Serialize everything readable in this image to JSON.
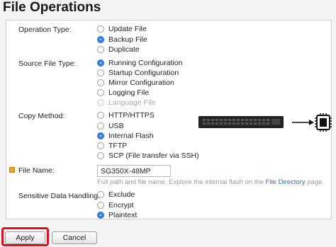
{
  "page": {
    "title": "File Operations"
  },
  "form": {
    "operation_type": {
      "label": "Operation Type:",
      "options": [
        {
          "label": "Update File",
          "checked": false,
          "disabled": false
        },
        {
          "label": "Backup File",
          "checked": true,
          "disabled": false
        },
        {
          "label": "Duplicate",
          "checked": false,
          "disabled": false
        }
      ]
    },
    "source_file_type": {
      "label": "Source File Type:",
      "options": [
        {
          "label": "Running Configuration",
          "checked": true,
          "disabled": false
        },
        {
          "label": "Startup Configuration",
          "checked": false,
          "disabled": false
        },
        {
          "label": "Mirror Configuration",
          "checked": false,
          "disabled": false
        },
        {
          "label": "Logging File",
          "checked": false,
          "disabled": false
        },
        {
          "label": "Language File",
          "checked": false,
          "disabled": true
        }
      ]
    },
    "copy_method": {
      "label": "Copy Method:",
      "options": [
        {
          "label": "HTTP/HTTPS",
          "checked": false,
          "disabled": false
        },
        {
          "label": "USB",
          "checked": false,
          "disabled": false
        },
        {
          "label": "Internal Flash",
          "checked": true,
          "disabled": false
        },
        {
          "label": "TFTP",
          "checked": false,
          "disabled": false
        },
        {
          "label": "SCP (File transfer via SSH)",
          "checked": false,
          "disabled": false
        }
      ]
    },
    "file_name": {
      "label": "File Name:",
      "value": "SG350X-48MP",
      "hint_prefix": "Full path and file name. Explore the internal flash on the",
      "hint_link": "File Directory",
      "hint_suffix": "page."
    },
    "sensitive_data": {
      "label": "Sensitive Data Handling:",
      "options": [
        {
          "label": "Exclude",
          "checked": false,
          "disabled": false
        },
        {
          "label": "Encrypt",
          "checked": false,
          "disabled": false
        },
        {
          "label": "Plaintext",
          "checked": true,
          "disabled": false
        }
      ]
    }
  },
  "buttons": {
    "apply": "Apply",
    "cancel": "Cancel"
  },
  "colors": {
    "accent": "#2f84e6",
    "highlight": "#d8121f",
    "required": "#f0a51c",
    "link": "#2a6fc8"
  },
  "icons": {
    "required": "required-field-icon",
    "switch": "switch-device-icon",
    "arrow": "arrow-right-icon",
    "chip": "flash-chip-icon"
  }
}
